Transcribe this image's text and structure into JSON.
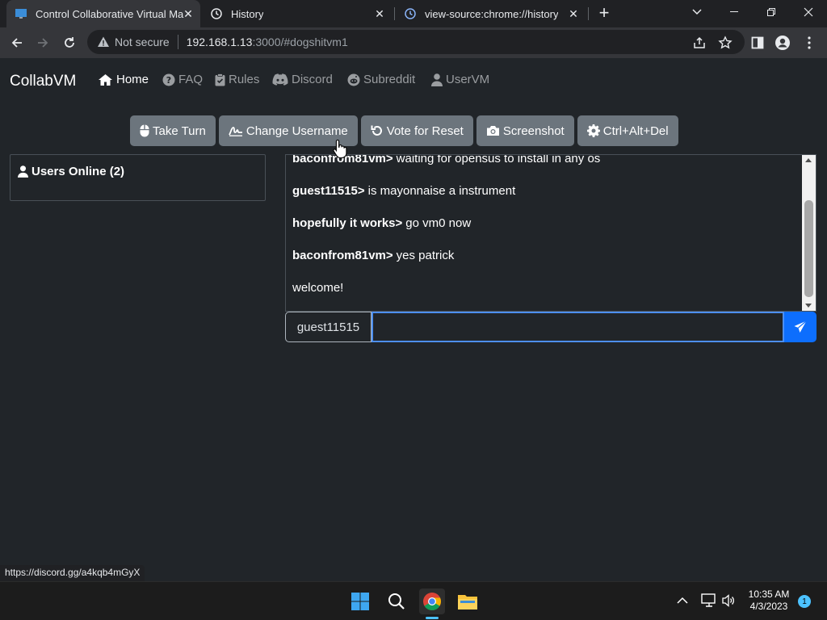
{
  "browser": {
    "tabs": [
      {
        "title": "Control Collaborative Virtual Ma",
        "active": true
      },
      {
        "title": "History",
        "active": false
      },
      {
        "title": "view-source:chrome://history",
        "active": false
      }
    ],
    "omnibox": {
      "security_label": "Not secure",
      "host": "192.168.1.13",
      "path": ":3000/#dogshitvm1"
    },
    "status_url": "https://discord.gg/a4kqb4mGyX"
  },
  "page": {
    "brand": "CollabVM",
    "nav": [
      {
        "label": "Home",
        "icon": "home-icon"
      },
      {
        "label": "FAQ",
        "icon": "question-circle-icon"
      },
      {
        "label": "Rules",
        "icon": "clipboard-check-icon"
      },
      {
        "label": "Discord",
        "icon": "discord-icon"
      },
      {
        "label": "Subreddit",
        "icon": "reddit-icon"
      },
      {
        "label": "UserVM",
        "icon": "user-icon"
      }
    ],
    "buttons": [
      {
        "label": "Take Turn",
        "icon": "mouse-icon"
      },
      {
        "label": "Change Username",
        "icon": "signature-icon"
      },
      {
        "label": "Vote for Reset",
        "icon": "rotate-left-icon"
      },
      {
        "label": "Screenshot",
        "icon": "camera-icon"
      },
      {
        "label": "Ctrl+Alt+Del",
        "icon": "gear-icon"
      }
    ],
    "users_online": "Users Online (2)",
    "chat": [
      {
        "user": "baconfrom81vm>",
        "text": "waiting for opensus to install in any os"
      },
      {
        "user": "guest11515>",
        "text": "is mayonnaise a instrument"
      },
      {
        "user": "hopefully it works>",
        "text": "go vm0 now"
      },
      {
        "user": "baconfrom81vm>",
        "text": "yes patrick"
      },
      {
        "user": "",
        "text": "welcome!"
      }
    ],
    "chat_username": "guest11515",
    "chat_input_value": ""
  },
  "taskbar": {
    "time": "10:35 AM",
    "date": "4/3/2023",
    "notification_count": "1"
  },
  "colors": {
    "page_bg": "#212529",
    "button_bg": "#6c757d",
    "send_button": "#0d6efd",
    "input_focus": "#4d8ff0"
  }
}
